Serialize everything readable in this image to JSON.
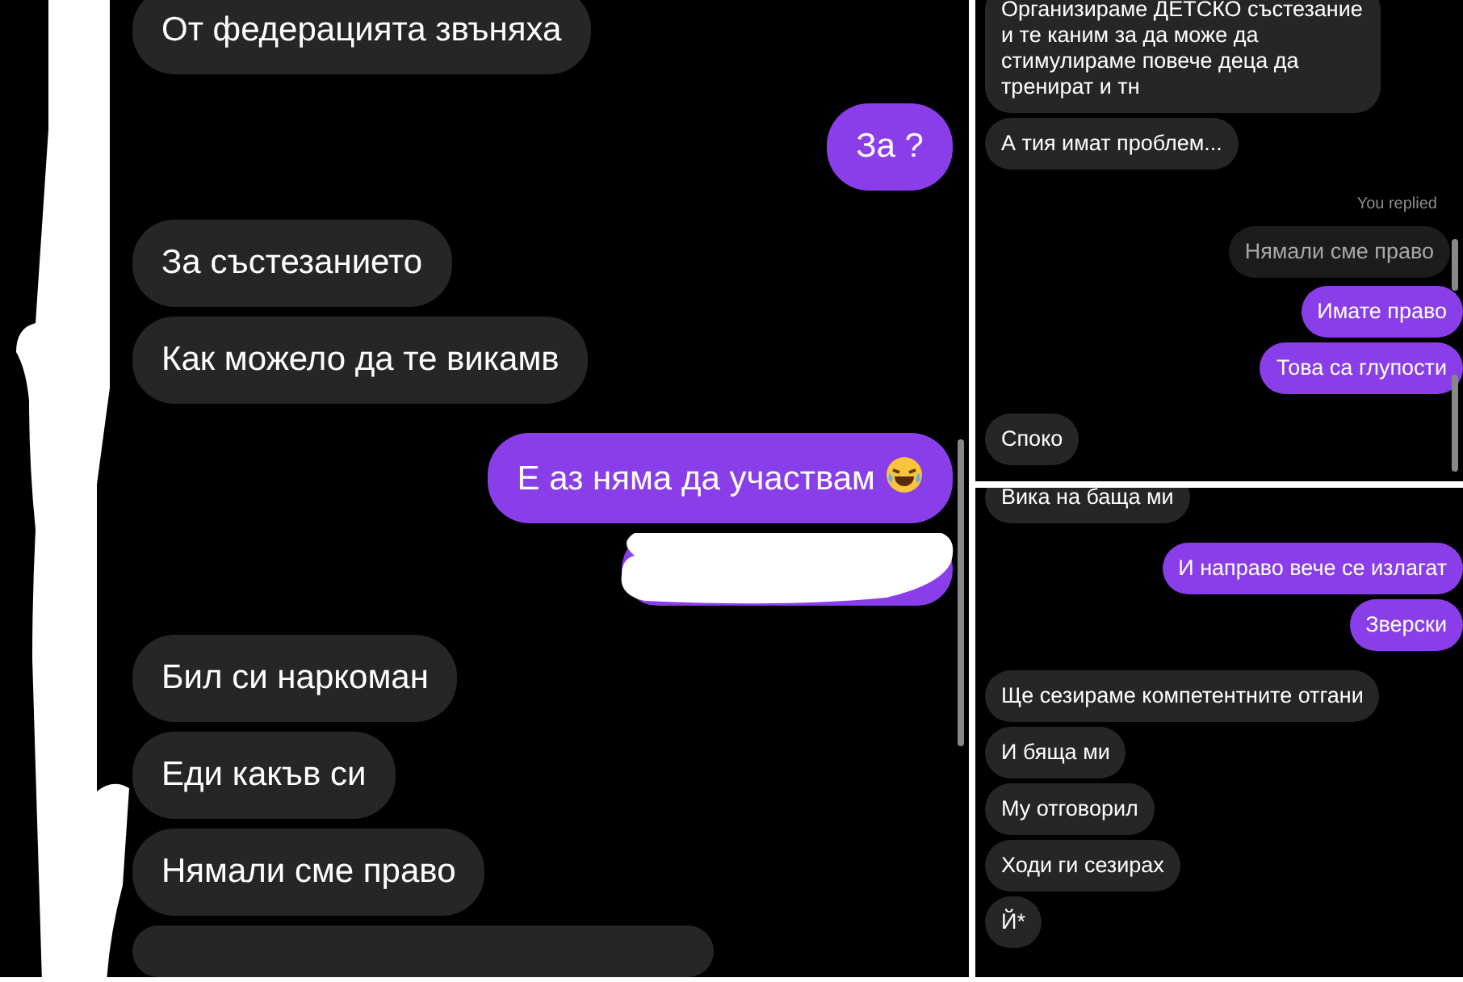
{
  "panels": [
    {
      "messages": [
        {
          "kind": "received",
          "text": "От федерацията звъняха"
        },
        {
          "kind": "sent",
          "text": "За ?"
        },
        {
          "kind": "received",
          "text": "За състезанието"
        },
        {
          "kind": "received",
          "text": "Как можело да те викамв"
        },
        {
          "kind": "sent",
          "text": "Е аз няма да участвам",
          "emoji": true
        },
        {
          "kind": "redacted"
        },
        {
          "kind": "received",
          "text": "Бил си наркоман"
        },
        {
          "kind": "received",
          "text": "Еди какъв си"
        },
        {
          "kind": "received",
          "text": "Нямали сме право"
        },
        {
          "kind": "cut"
        }
      ]
    },
    {
      "messages": [
        {
          "kind": "received",
          "text": "Организираме ДЕТСКО състезание и те каним за да може да стимулираме повече деца да тренират и тн"
        },
        {
          "kind": "received",
          "text": "А тия имат проблем..."
        },
        {
          "kind": "reply_label",
          "text": "You replied"
        },
        {
          "kind": "quote",
          "text": "Нямали сме право"
        },
        {
          "kind": "sent",
          "text": "Имате право"
        },
        {
          "kind": "sent",
          "text": "Това са глупости"
        },
        {
          "kind": "received",
          "text": "Споко"
        }
      ]
    },
    {
      "messages": [
        {
          "kind": "received",
          "text": "Вика на баща ми"
        },
        {
          "kind": "sent",
          "text": "И направо вече се излагат"
        },
        {
          "kind": "sent",
          "text": "Зверски"
        },
        {
          "kind": "received",
          "text": "Ще сезираме компетентните отгани"
        },
        {
          "kind": "received",
          "text": "И бяща ми"
        },
        {
          "kind": "received",
          "text": "Му отговорил"
        },
        {
          "kind": "received",
          "text": "Ходи ги сезирах"
        },
        {
          "kind": "received",
          "text": "Й*"
        }
      ]
    }
  ]
}
